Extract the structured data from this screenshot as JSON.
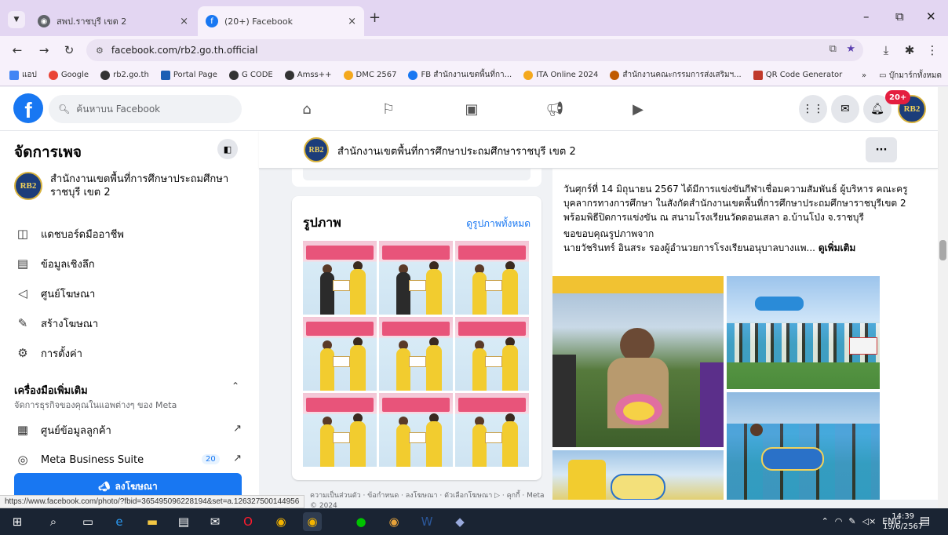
{
  "browser": {
    "tabs": [
      {
        "title": "สพป.ราชบุรี เขต 2",
        "close": "×"
      },
      {
        "title": "(20+) Facebook",
        "close": "×"
      }
    ],
    "new_tab": "+",
    "window_controls": {
      "minimize": "–",
      "restore": "⧉",
      "close": "✕"
    },
    "url": "facebook.com/rb2.go.th.official",
    "bookmarks": [
      {
        "label": "แอป",
        "color": "#4285f4"
      },
      {
        "label": "Google",
        "color": "#ea4335"
      },
      {
        "label": "rb2.go.th",
        "color": "#333333"
      },
      {
        "label": "Portal Page",
        "color": "#1a5fb4"
      },
      {
        "label": "G CODE",
        "color": "#333333"
      },
      {
        "label": "Amss++",
        "color": "#333333"
      },
      {
        "label": "DMC 2567",
        "color": "#f4a81d"
      },
      {
        "label": "FB สำนักงานเขตพื้นที่กา...",
        "color": "#1877f2"
      },
      {
        "label": "ITA Online 2024",
        "color": "#f4a81d"
      },
      {
        "label": "สำนักงานคณะกรรมการส่งเสริมฯ...",
        "color": "#c05a00"
      },
      {
        "label": "QR Code Generator",
        "color": "#c0392b"
      }
    ],
    "bookmarks_more": "»",
    "bookmarks_folder": "บุ๊กมาร์กทั้งหมด",
    "status_url": "https://www.facebook.com/photo/?fbid=365495096228194&set=a.126327500144956"
  },
  "facebook": {
    "search_placeholder": "ค้นหาบน Facebook",
    "notification_badge": "20+",
    "sidebar": {
      "title": "จัดการเพจ",
      "page_name": "สำนักงานเขตพื้นที่การศึกษาประถมศึกษาราชบุรี เขต 2",
      "items": [
        {
          "label": "แดชบอร์ดมืออาชีพ",
          "icon": "dashboard-icon"
        },
        {
          "label": "ข้อมูลเชิงลึก",
          "icon": "insights-icon"
        },
        {
          "label": "ศูนย์โฆษณา",
          "icon": "megaphone-icon"
        },
        {
          "label": "สร้างโฆษณา",
          "icon": "edit-icon"
        },
        {
          "label": "การตั้งค่า",
          "icon": "gear-icon"
        }
      ],
      "tools_title": "เครื่องมือเพิ่มเติม",
      "tools_subtitle": "จัดการธุรกิจของคุณในแอพต่างๆ ของ Meta",
      "tools": [
        {
          "label": "ศูนย์ข้อมูลลูกค้า"
        },
        {
          "label": "Meta Business Suite",
          "count": "20"
        }
      ],
      "promote_label": "ลงโฆษณา"
    },
    "page_header": {
      "name": "สำนักงานเขตพื้นที่การศึกษาประถมศึกษาราชบุรี เขต 2",
      "more": "···"
    },
    "photos": {
      "title": "รูปภาพ",
      "see_all": "ดูรูปภาพทั้งหมด",
      "count": 9
    },
    "post": {
      "paragraph1": "วันศุกร์ที่ 14 มิถุนายน 2567 ได้มีการแข่งขันกีฬาเชื่อมความสัมพันธ์ ผู้บริหาร คณะครู บุคลากรทางการศึกษา ในสังกัดสำนักงานเขตพื้นที่การศึกษาประถมศึกษาราชบุรีเขต 2 พร้อมพิธีปิดการแข่งขัน ณ สนามโรงเรียนวัดดอนเสลา อ.บ้านโป่ง จ.ราชบุรี",
      "paragraph2": "ขอขอบคุณรูปภาพจาก",
      "paragraph3": "นายวัชรินทร์ อินสระ รองผู้อำนวยการโรงเรียนอนุบาลบางแพ...",
      "see_more": "ดูเพิ่มเติม"
    },
    "footer": "ความเป็นส่วนตัว · ข้อกำหนด · ลงโฆษณา · ตัวเลือกโฆษณา ▷ · คุกกี้ · Meta © 2024"
  },
  "taskbar": {
    "tray_lang": "ENG",
    "time": "14:39",
    "date": "19/6/2567"
  }
}
